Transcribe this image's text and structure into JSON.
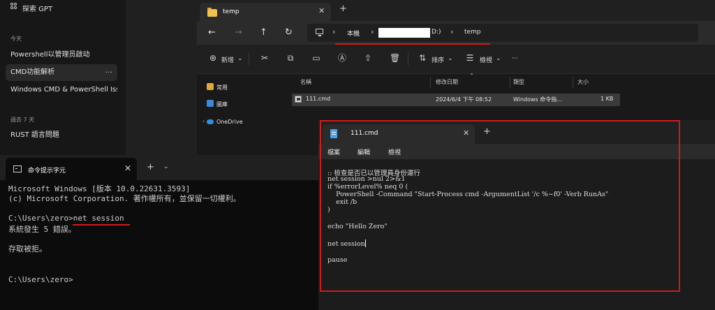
{
  "chat_sidebar": {
    "explore_label": "探索 GPT",
    "section_today": "今天",
    "section_past7": "過去 7 天",
    "items": [
      {
        "label": "Powershell以管理员啟动"
      },
      {
        "label": "CMD功能解析"
      },
      {
        "label": "Windows CMD & PowerShell Iss"
      },
      {
        "label": "RUST 語言問題"
      }
    ],
    "more_glyph": "···"
  },
  "explorer": {
    "tab_title": "temp",
    "tab_close": "✕",
    "new_tab": "+",
    "nav": {
      "back": "←",
      "forward": "→",
      "up": "↑",
      "refresh": "↻"
    },
    "breadcrumb": {
      "sep": "›",
      "this_pc": "本機",
      "drive": "D:)",
      "folder": "temp"
    },
    "toolbar": {
      "new_label": "新增",
      "sort_label": "排序",
      "view_label": "檢視",
      "more": "···"
    },
    "nav_pane": [
      {
        "label": "常用"
      },
      {
        "label": "圖庫"
      },
      {
        "label": "OneDrive"
      }
    ],
    "columns": {
      "name": "名稱",
      "modified": "修改日期",
      "type": "類型",
      "size": "大小"
    },
    "files": [
      {
        "name": "111.cmd",
        "modified": "2024/6/4 下午 08:52",
        "type": "Windows 命令指...",
        "size": "1 KB"
      }
    ]
  },
  "cmd": {
    "tab_title": "命令提示字元",
    "tab_close": "✕",
    "plus": "+",
    "dropdown": "⌄",
    "lines": [
      "Microsoft Windows [版本 10.0.22631.3593]",
      "(c) Microsoft Corporation. 著作權所有，並保留一切權利。",
      "",
      "C:\\Users\\zero>net session",
      "系統發生 5 錯誤。",
      "",
      "存取被拒。",
      "",
      "",
      "C:\\Users\\zero>"
    ]
  },
  "notepad": {
    "tab_title": "111.cmd",
    "tab_close": "✕",
    "plus": "+",
    "menu": {
      "file": "檔案",
      "edit": "編輯",
      "view": "檢視"
    },
    "lines": [
      ":: 檢查是否已以管理員身份運行",
      "net session >nul 2>&1",
      "if %errorLevel% neq 0 (",
      "    PowerShell -Command \"Start-Process cmd -ArgumentList '/c %~f0' -Verb RunAs\"",
      "    exit /b",
      ")",
      "",
      "echo \"Hello Zero\"",
      "",
      "net session",
      "",
      "pause"
    ]
  },
  "colors": {
    "accent_red": "#d11a1a",
    "folder": "#f2c14e",
    "notepad_icon": "#4aa3e8"
  }
}
